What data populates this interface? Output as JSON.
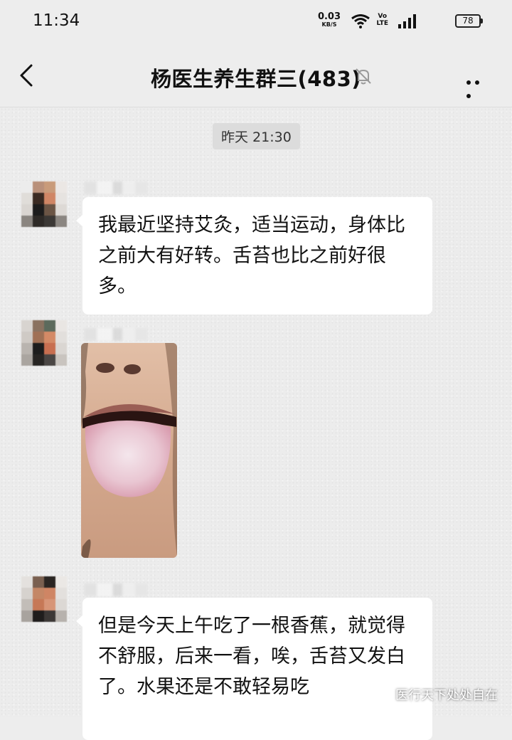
{
  "status_bar": {
    "time": "11:34",
    "net_speed_value": "0.03",
    "net_speed_unit": "KB/S",
    "volte_top": "Vo",
    "volte_bottom": "LTE",
    "battery": "78"
  },
  "nav": {
    "title": "杨医生养生群三(483)",
    "icons": {
      "back": "back-chevron-icon",
      "mute": "bell-muted-icon",
      "more": "more-dots-icon"
    }
  },
  "chat": {
    "time_divider": "昨天 21:30",
    "messages": [
      {
        "type": "text",
        "text": "我最近坚持艾灸，适当运动，身体比之前大有好转。舌苔也比之前好很多。"
      },
      {
        "type": "image",
        "description_icon": "photo-icon"
      },
      {
        "type": "text",
        "text": "但是今天上午吃了一根香蕉，就觉得不舒服，后来一看，唉，舌苔又发白了。水果还是不敢轻易吃"
      }
    ]
  },
  "watermark": {
    "text": "医行天下处处自在",
    "icon": "wechat-official-account-icon"
  },
  "colors": {
    "bubble": "#ffffff",
    "background": "#ededed",
    "divider_bg": "#dcdcdc"
  }
}
